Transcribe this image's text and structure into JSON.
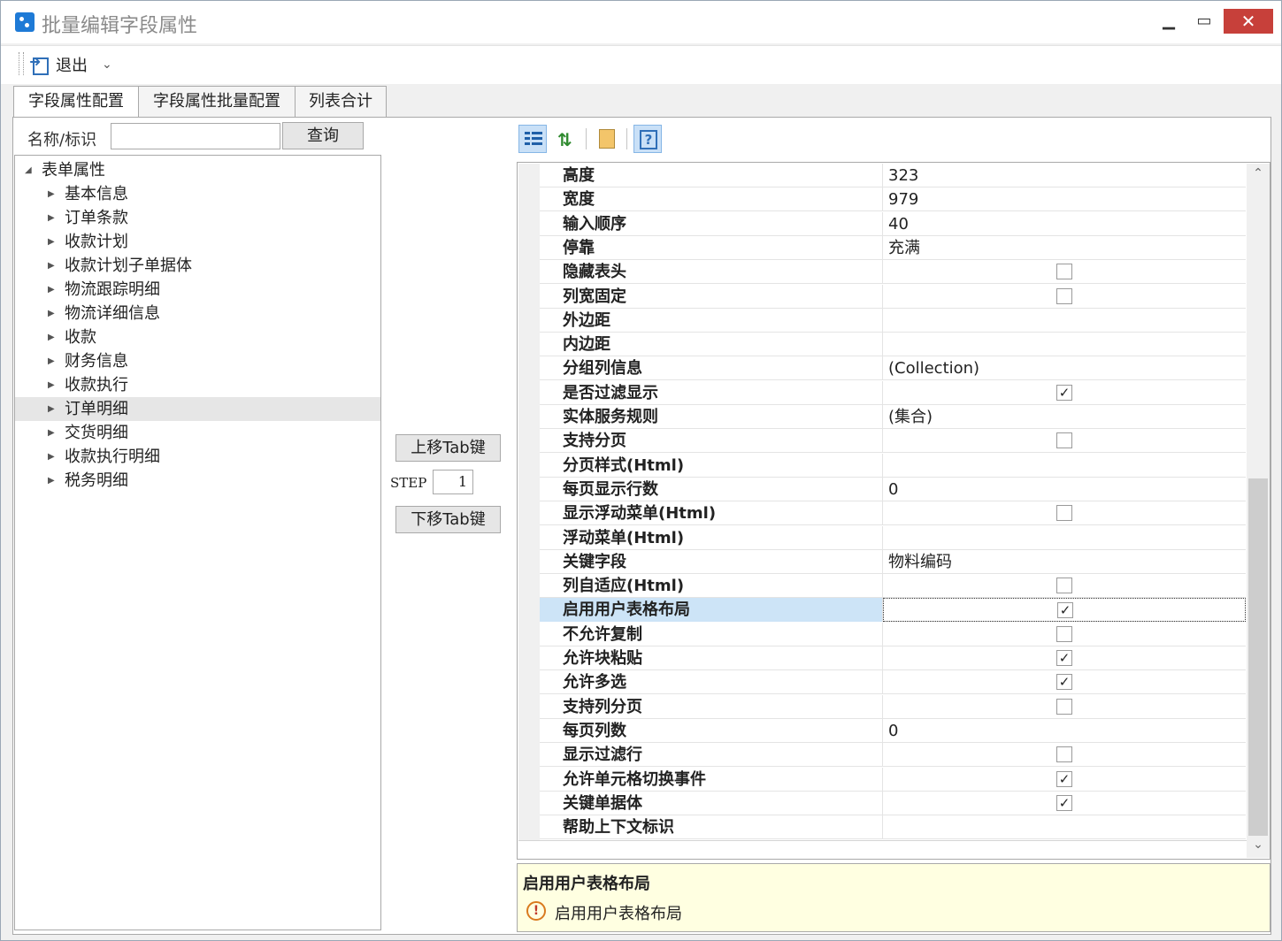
{
  "window": {
    "title": "批量编辑字段属性",
    "min_glyph": "▁",
    "max_glyph": "▭",
    "close_glyph": "✕"
  },
  "toolbar": {
    "exit_label": "退出",
    "dropdown_glyph": "⌄"
  },
  "tabs": [
    {
      "label": "字段属性配置",
      "active": true
    },
    {
      "label": "字段属性批量配置",
      "active": false
    },
    {
      "label": "列表合计",
      "active": false
    }
  ],
  "search": {
    "label": "名称/标识",
    "value": "",
    "button_label": "查询"
  },
  "tree": {
    "root": {
      "label": "表单属性",
      "arrow": "◢"
    },
    "children_arrow": "▶",
    "children": [
      {
        "label": "基本信息",
        "selected": false
      },
      {
        "label": "订单条款",
        "selected": false
      },
      {
        "label": "收款计划",
        "selected": false
      },
      {
        "label": "收款计划子单据体",
        "selected": false
      },
      {
        "label": "物流跟踪明细",
        "selected": false
      },
      {
        "label": "物流详细信息",
        "selected": false
      },
      {
        "label": "收款",
        "selected": false
      },
      {
        "label": "财务信息",
        "selected": false
      },
      {
        "label": "收款执行",
        "selected": false
      },
      {
        "label": "订单明细",
        "selected": true
      },
      {
        "label": "交货明细",
        "selected": false
      },
      {
        "label": "收款执行明细",
        "selected": false
      },
      {
        "label": "税务明细",
        "selected": false
      }
    ]
  },
  "mid": {
    "up_label": "上移Tab键",
    "step_label": "STEP",
    "step_value": "1",
    "down_label": "下移Tab键"
  },
  "property_grid": {
    "toolbar_icons": [
      "categorized-icon",
      "sort-alpha-icon",
      "property-pages-icon",
      "help-icon"
    ],
    "help_glyph": "?",
    "sort_glyph": "⇅",
    "check_glyph": "✓",
    "scroll_up_glyph": "⌃",
    "scroll_down_glyph": "⌄",
    "rows": [
      {
        "name": "高度",
        "type": "text",
        "value": "323"
      },
      {
        "name": "宽度",
        "type": "text",
        "value": "979"
      },
      {
        "name": "输入顺序",
        "type": "text",
        "value": "40"
      },
      {
        "name": "停靠",
        "type": "text",
        "value": "充满"
      },
      {
        "name": "隐藏表头",
        "type": "check",
        "checked": false
      },
      {
        "name": "列宽固定",
        "type": "check",
        "checked": false
      },
      {
        "name": "外边距",
        "type": "text",
        "value": ""
      },
      {
        "name": "内边距",
        "type": "text",
        "value": ""
      },
      {
        "name": "分组列信息",
        "type": "text",
        "value": "(Collection)"
      },
      {
        "name": "是否过滤显示",
        "type": "check",
        "checked": true
      },
      {
        "name": "实体服务规则",
        "type": "text",
        "value": "(集合)"
      },
      {
        "name": "支持分页",
        "type": "check",
        "checked": false
      },
      {
        "name": "分页样式(Html)",
        "type": "text",
        "value": ""
      },
      {
        "name": "每页显示行数",
        "type": "text",
        "value": "0"
      },
      {
        "name": "显示浮动菜单(Html)",
        "type": "check",
        "checked": false
      },
      {
        "name": "浮动菜单(Html)",
        "type": "text",
        "value": ""
      },
      {
        "name": "关键字段",
        "type": "text",
        "value": "物料编码"
      },
      {
        "name": "列自适应(Html)",
        "type": "check",
        "checked": false
      },
      {
        "name": "启用用户表格布局",
        "type": "check",
        "checked": true,
        "selected": true
      },
      {
        "name": "不允许复制",
        "type": "check",
        "checked": false
      },
      {
        "name": "允许块粘贴",
        "type": "check",
        "checked": true
      },
      {
        "name": "允许多选",
        "type": "check",
        "checked": true
      },
      {
        "name": "支持列分页",
        "type": "check",
        "checked": false
      },
      {
        "name": "每页列数",
        "type": "text",
        "value": "0"
      },
      {
        "name": "显示过滤行",
        "type": "check",
        "checked": false
      },
      {
        "name": "允许单元格切换事件",
        "type": "check",
        "checked": true
      },
      {
        "name": "关键单据体",
        "type": "check",
        "checked": true
      },
      {
        "name": "帮助上下文标识",
        "type": "text",
        "value": ""
      }
    ]
  },
  "description": {
    "title": "启用用户表格布局",
    "icon_glyph": "!",
    "text": "启用用户表格布局"
  }
}
